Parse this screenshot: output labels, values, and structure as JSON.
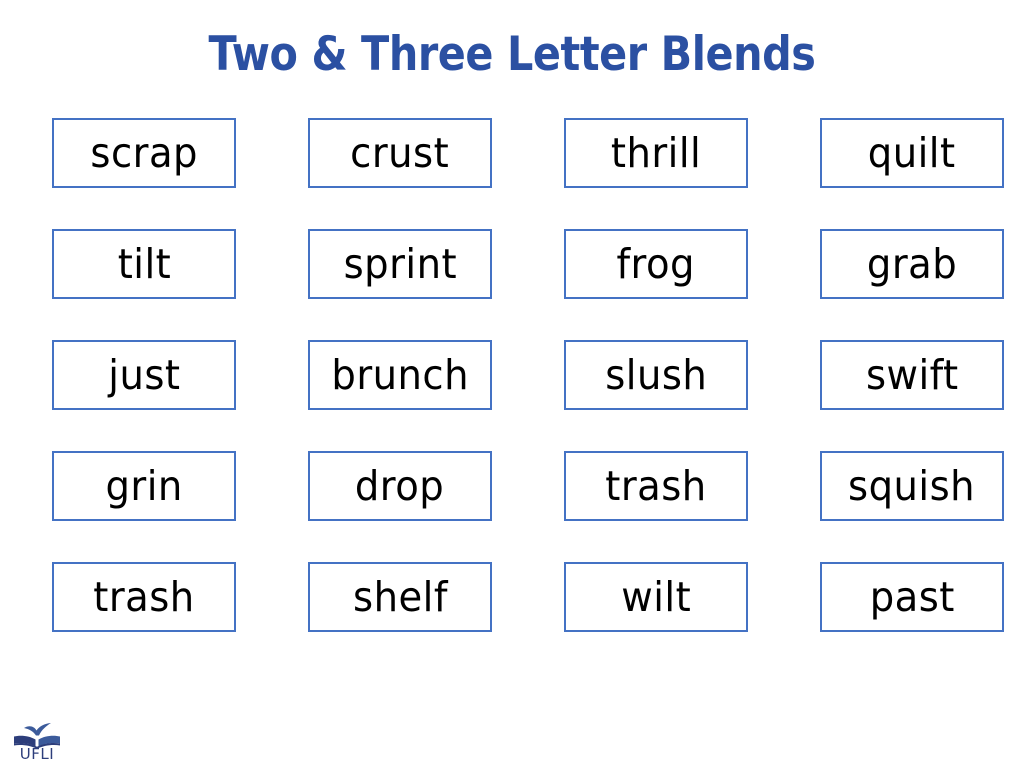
{
  "slide": {
    "title": "Two & Three Letter Blends",
    "title_color": "#2B50A2",
    "background_color": "#FFFFFF",
    "card_border_color": "#4472C4",
    "word_color": "#000000"
  },
  "grid": {
    "columns": 4,
    "rows": 5,
    "cards": [
      {
        "word": "scrap"
      },
      {
        "word": "crust"
      },
      {
        "word": "thrill"
      },
      {
        "word": "quilt"
      },
      {
        "word": "tilt"
      },
      {
        "word": "sprint"
      },
      {
        "word": "frog"
      },
      {
        "word": "grab"
      },
      {
        "word": "just"
      },
      {
        "word": "brunch"
      },
      {
        "word": "slush"
      },
      {
        "word": "swift"
      },
      {
        "word": "grin"
      },
      {
        "word": "drop"
      },
      {
        "word": "trash"
      },
      {
        "word": "squish"
      },
      {
        "word": "trash"
      },
      {
        "word": "shelf"
      },
      {
        "word": "wilt"
      },
      {
        "word": "past"
      }
    ]
  },
  "logo": {
    "name": "ufli-logo",
    "text": "UFLI",
    "color": "#2D3E7B",
    "book_color": "#3C5B9B",
    "icon": "open-book-icon"
  }
}
